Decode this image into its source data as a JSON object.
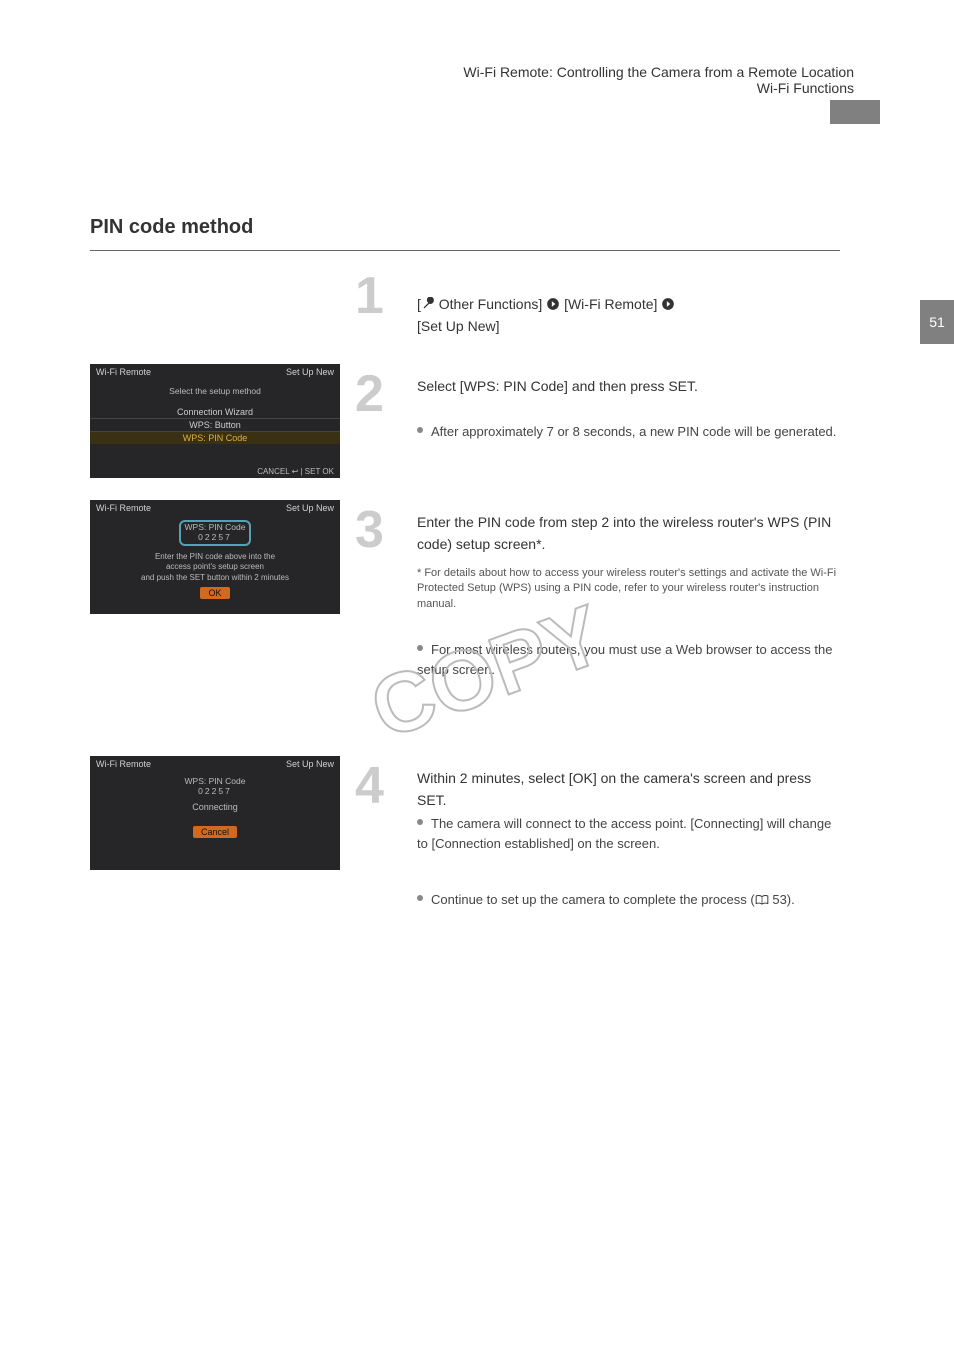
{
  "header": {
    "line1": "Wi-Fi Remote: Controlling the Camera from a Remote Location",
    "line2": "Wi-Fi Functions"
  },
  "sidebar_pageno": "51",
  "page_title": "PIN code method",
  "steps": {
    "s1": {
      "num": "1",
      "text_pre": "[",
      "text_mid1": " Other Functions] ",
      "text_mid2": " [Wi-Fi Remote] ",
      "text_post": " [Set Up New]"
    },
    "s2": {
      "num": "2",
      "text": "Select [WPS: PIN Code] and then press SET.",
      "bullet": "After approximately 7 or 8 seconds, a new PIN code will be generated."
    },
    "s3": {
      "num": "3",
      "text": "Enter the PIN code from step 2 into the wireless router's WPS (PIN code) setup screen*.",
      "bullet": "For most wireless routers, you must use a Web browser to access the setup screen.",
      "note": "* For details about how to access your wireless router's settings and activate the Wi-Fi Protected Setup (WPS) using a PIN code, refer to your wireless router's instruction manual."
    },
    "s4": {
      "num": "4",
      "text": "Within 2 minutes, select [OK] on the camera's screen and press SET.",
      "bullet1": "The camera will connect to the access point. [Connecting] will change to [Connection established] on the screen.",
      "bullet2_pre": "Continue to set up the camera to complete the process (",
      "bullet2_ref": " 53).",
      "bullet2_post": ""
    }
  },
  "icons": {
    "wrench": "",
    "arrow_right": "",
    "book": ""
  },
  "screenshots": {
    "shot1": {
      "left": "Wi-Fi Remote",
      "right": "Set Up New",
      "subtitle": "Select the setup method",
      "opt1": "Connection Wizard",
      "opt2": "WPS: Button",
      "opt3": "WPS: PIN Code",
      "footer": "CANCEL ↩ | SET OK"
    },
    "shot2": {
      "left": "Wi-Fi Remote",
      "right": "Set Up New",
      "box_top": "WPS: PIN Code",
      "box_code": "02257",
      "line1": "Enter the PIN code above into the",
      "line2": "access point's setup screen",
      "line3": "and push the SET button within 2 minutes",
      "btn": "OK"
    },
    "shot3": {
      "left": "Wi-Fi Remote",
      "right": "Set Up New",
      "box_top": "WPS: PIN Code",
      "box_code": "02257",
      "status": "Connecting",
      "btn": "Cancel"
    }
  }
}
